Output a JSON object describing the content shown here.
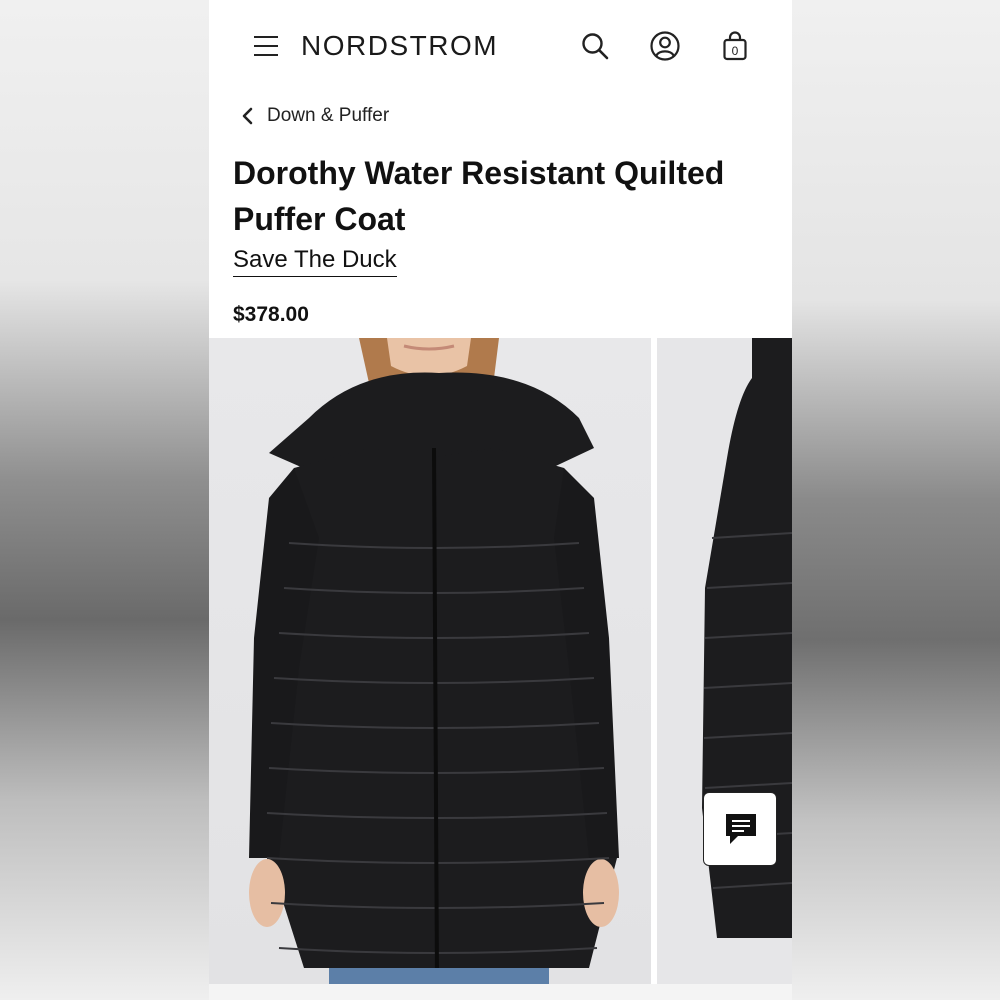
{
  "header": {
    "logo": "NORDSTROM",
    "menu_icon": "hamburger-menu-icon",
    "search_icon": "search-icon",
    "account_icon": "account-icon",
    "bag_icon": "shopping-bag-icon",
    "bag_count": "0"
  },
  "breadcrumb": {
    "back_icon": "chevron-left-icon",
    "label": "Down & Puffer"
  },
  "product": {
    "title": "Dorothy Water Resistant Quilted Puffer Coat",
    "brand": "Save The Duck",
    "price": "$378.00"
  },
  "gallery": {
    "images": [
      "front-view-photo",
      "side-view-photo"
    ]
  },
  "chat": {
    "icon": "chat-icon"
  },
  "colors": {
    "text": "#111111",
    "background": "#ffffff",
    "photo_background": "#e4e4e6",
    "coat": "#1c1c1e"
  }
}
